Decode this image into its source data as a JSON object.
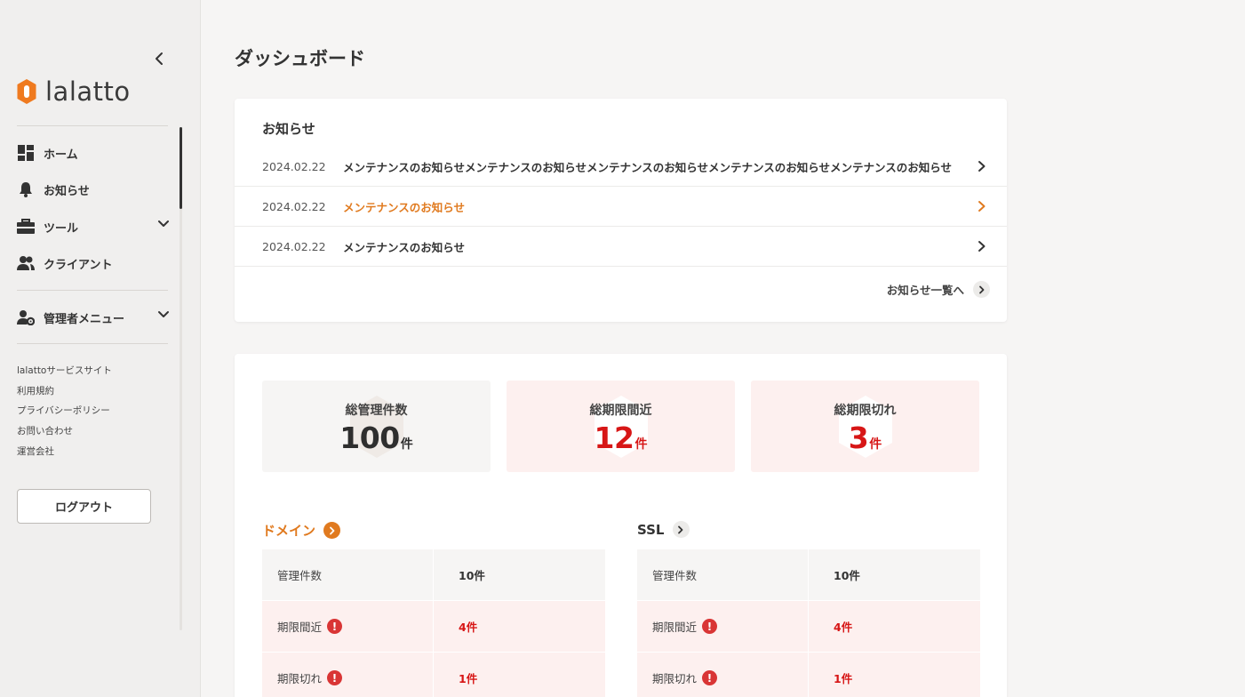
{
  "sidebar": {
    "logo_text": "lalatto",
    "nav": [
      {
        "label": "ホーム",
        "icon": "dashboard-grid-icon"
      },
      {
        "label": "お知らせ",
        "icon": "bell-icon"
      },
      {
        "label": "ツール",
        "icon": "toolbox-icon",
        "expandable": true
      },
      {
        "label": "クライアント",
        "icon": "users-icon"
      }
    ],
    "admin_menu": {
      "label": "管理者メニュー",
      "icon": "user-gear-icon",
      "expandable": true
    },
    "links": [
      "lalattoサービスサイト",
      "利用規約",
      "プライバシーポリシー",
      "お問い合わせ",
      "運営会社"
    ],
    "logout_label": "ログアウト"
  },
  "page": {
    "title": "ダッシュボード"
  },
  "news": {
    "title": "お知らせ",
    "items": [
      {
        "date": "2024.02.22",
        "text": "メンテナンスのお知らせメンテナンスのお知らせメンテナンスのお知らせメンテナンスのお知らせメンテナンスのお知らせ",
        "highlighted": false
      },
      {
        "date": "2024.02.22",
        "text": "メンテナンスのお知らせ",
        "highlighted": true
      },
      {
        "date": "2024.02.22",
        "text": "メンテナンスのお知らせ",
        "highlighted": false
      }
    ],
    "more_label": "お知らせ一覧へ"
  },
  "stats": [
    {
      "label": "総管理件数",
      "value": "100",
      "unit": "件",
      "status": "neutral"
    },
    {
      "label": "総期限間近",
      "value": "12",
      "unit": "件",
      "status": "warning"
    },
    {
      "label": "総期限切れ",
      "value": "3",
      "unit": "件",
      "status": "warning"
    }
  ],
  "sections": {
    "domain": {
      "title": "ドメイン",
      "rows": [
        {
          "label": "管理件数",
          "value": "10件",
          "alert": false
        },
        {
          "label": "期限間近",
          "value": "4件",
          "alert": true
        },
        {
          "label": "期限切れ",
          "value": "1件",
          "alert": true
        }
      ]
    },
    "ssl": {
      "title": "SSL",
      "rows": [
        {
          "label": "管理件数",
          "value": "10件",
          "alert": false
        },
        {
          "label": "期限間近",
          "value": "4件",
          "alert": true
        },
        {
          "label": "期限切れ",
          "value": "1件",
          "alert": true
        }
      ]
    }
  },
  "colors": {
    "accent": "#e07a1f",
    "danger": "#d71616",
    "alert_icon": "#d93535",
    "warning_bg": "#fdf0ef"
  }
}
